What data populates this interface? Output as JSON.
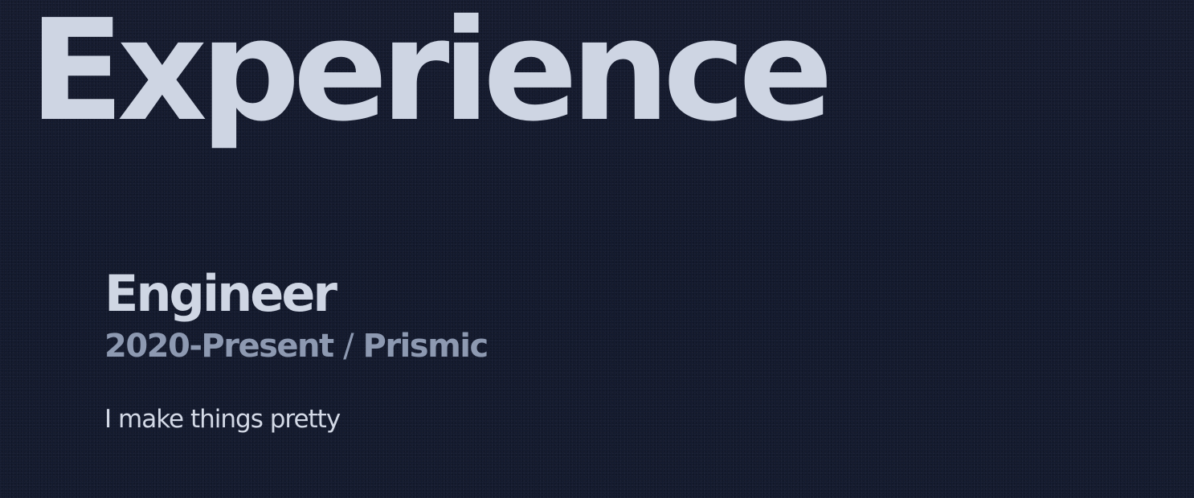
{
  "section": {
    "heading": "Experience"
  },
  "experience": [
    {
      "title": "Engineer",
      "period": "2020-Present",
      "separator": "/",
      "company": "Prismic",
      "description": "I make things pretty"
    }
  ],
  "colors": {
    "background": "#141b2f",
    "heading": "#ced5e3",
    "title": "#cfd6e4",
    "meta": "#8d99b1",
    "description": "#d3d9e6"
  }
}
